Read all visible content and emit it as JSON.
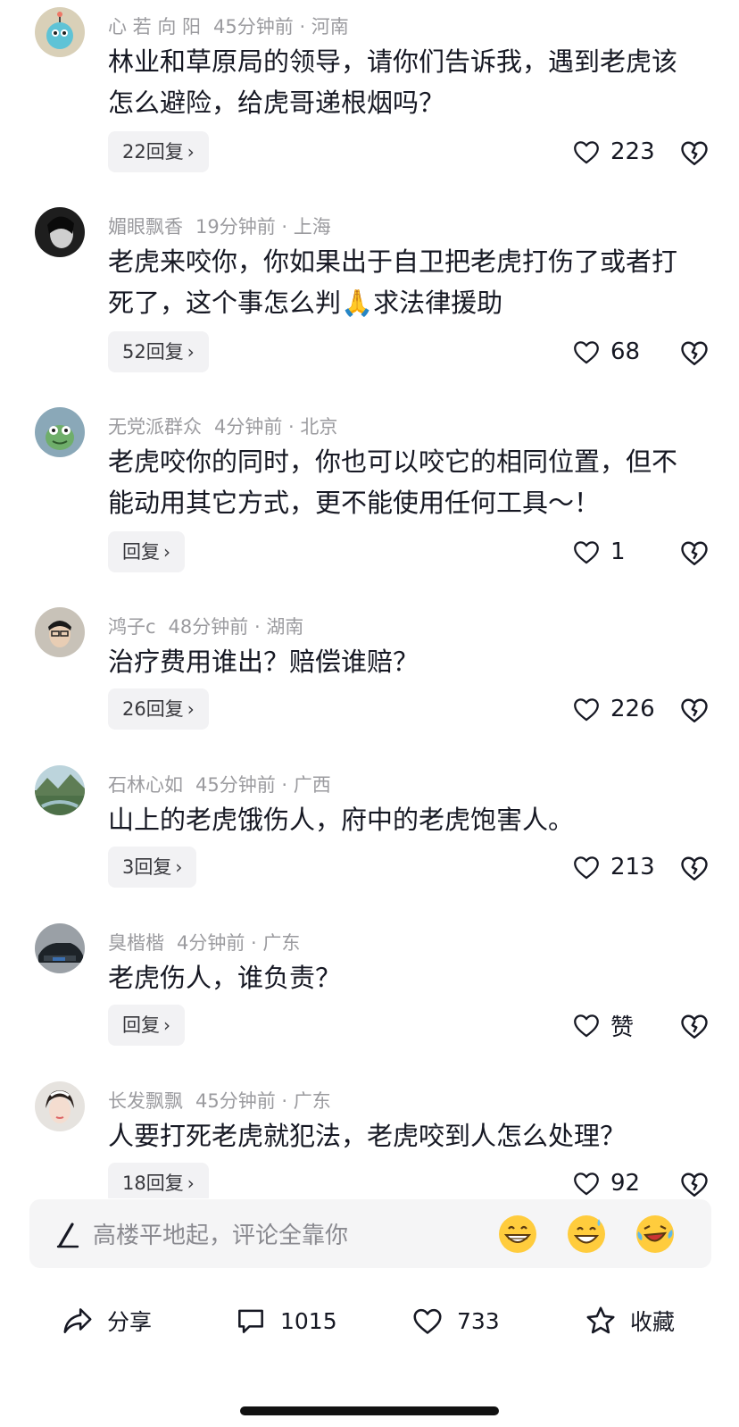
{
  "comments": [
    {
      "username": "心 若 向 阳",
      "time": "45分钟前",
      "location": "河南",
      "text": "林业和草原局的领导，请你们告诉我，遇到老虎该怎么避险，给虎哥递根烟吗？",
      "reply_label": "22回复",
      "likes": "223"
    },
    {
      "username": "媚眼飘香",
      "time": "19分钟前",
      "location": "上海",
      "text": "老虎来咬你，你如果出于自卫把老虎打伤了或者打死了，这个事怎么判🙏求法律援助",
      "reply_label": "52回复",
      "likes": "68"
    },
    {
      "username": "无党派群众",
      "time": "4分钟前",
      "location": "北京",
      "text": "老虎咬你的同时，你也可以咬它的相同位置，但不能动用其它方式，更不能使用任何工具～！",
      "reply_label": "回复",
      "likes": "1"
    },
    {
      "username": "鸿子c",
      "time": "48分钟前",
      "location": "湖南",
      "text": "治疗费用谁出？赔偿谁赔？",
      "reply_label": "26回复",
      "likes": "226"
    },
    {
      "username": "石林心如",
      "time": "45分钟前",
      "location": "广西",
      "text": "山上的老虎饿伤人，府中的老虎饱害人。",
      "reply_label": "3回复",
      "likes": "213"
    },
    {
      "username": "臭楷楷",
      "time": "4分钟前",
      "location": "广东",
      "text": "老虎伤人，谁负责？",
      "reply_label": "回复",
      "likes": "赞"
    },
    {
      "username": "长发飘飘",
      "time": "45分钟前",
      "location": "广东",
      "text": "人要打死老虎就犯法，老虎咬到人怎么处理？",
      "reply_label": "18回复",
      "likes": "92"
    }
  ],
  "input": {
    "placeholder": "高楼平地起，评论全靠你"
  },
  "bottom_bar": {
    "share_label": "分享",
    "comment_count": "1015",
    "like_count": "733",
    "favorite_label": "收藏"
  },
  "icons": {
    "like": "heart-icon",
    "dislike": "broken-heart-icon",
    "share": "share-arrow-icon",
    "comment": "comment-bubble-icon",
    "favorite": "star-icon",
    "pen": "pen-icon"
  },
  "colors": {
    "meta": "#9b9b9f",
    "text": "#161823",
    "reply_bg": "#f2f2f4",
    "input_bg": "#f5f5f6"
  }
}
